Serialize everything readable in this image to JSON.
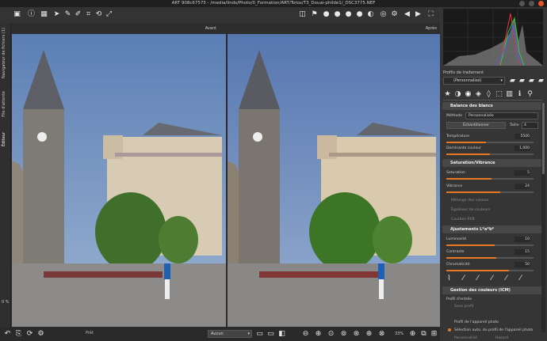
{
  "window": {
    "title": "ART 908c67575 - /media/linds/Photo/0_Formation/ART/Totos/T3_Douai-philde1/_DSC3775.NEF"
  },
  "toolbar": {
    "icons": [
      "camera-icon",
      "info-icon",
      "crop-icon",
      "select-icon",
      "eyedropper-icon",
      "brush-icon",
      "crop-tool-icon",
      "transform-icon",
      "expand-icon"
    ]
  },
  "side_tabs": [
    "Navigateur de fichiers (1)",
    "File d'attente",
    "Éditeur"
  ],
  "side_percent": "0 %",
  "preview": {
    "before_label": "Avant",
    "after_label": "Après"
  },
  "bottom": {
    "left_label": "Prêt",
    "select_value": "Aucun",
    "zoom": "33%"
  },
  "right_panel": {
    "profile_header": "Profils de traitement",
    "profile_value": "(Personnalisé)",
    "sections": {
      "white_balance": {
        "title": "Balance des blancs",
        "method_label": "Méthode",
        "method_value": "Personnalisée",
        "sample_label": "Échantillonner",
        "size_label": "Taille",
        "size_value": "4",
        "temperature_label": "Température",
        "temperature_value": "5500",
        "tint_label": "Dominante couleur",
        "tint_value": "1,000"
      },
      "saturation": {
        "title": "Saturation/Vibrance",
        "saturation_label": "Saturation",
        "saturation_value": "5",
        "vibrance_label": "Vibrance",
        "vibrance_value": "24"
      },
      "collapsed": [
        "Mélange des canaux",
        "Égaliseur de couleurs",
        "Courbes RVB"
      ],
      "lab": {
        "title": "Ajustements L*a*b*",
        "lightness_label": "Luminosité",
        "lightness_value": "10",
        "contrast_label": "Contraste",
        "contrast_value": "15",
        "chroma_label": "Chromaticité",
        "chroma_value": "50"
      },
      "icm": {
        "title": "Gestion des couleurs (ICM)",
        "input_label": "Profil d'entrée",
        "opt_none": "Sans profil",
        "opt_camera": "Profil de l'appareil photo",
        "opt_auto": "Sélection auto. du profil de l'appareil photo",
        "opt_custom": "Personnalisé",
        "opt_custom_value": "Hasard"
      }
    }
  },
  "colors": {
    "accent": "#e87722",
    "panel": "#353535",
    "header": "#474747"
  },
  "progress": {
    "temperature": 0.45,
    "tint": 0.5,
    "saturation": 0.52,
    "vibrance": 0.62,
    "lightness": 0.55,
    "contrast": 0.57,
    "chroma": 0.72
  }
}
